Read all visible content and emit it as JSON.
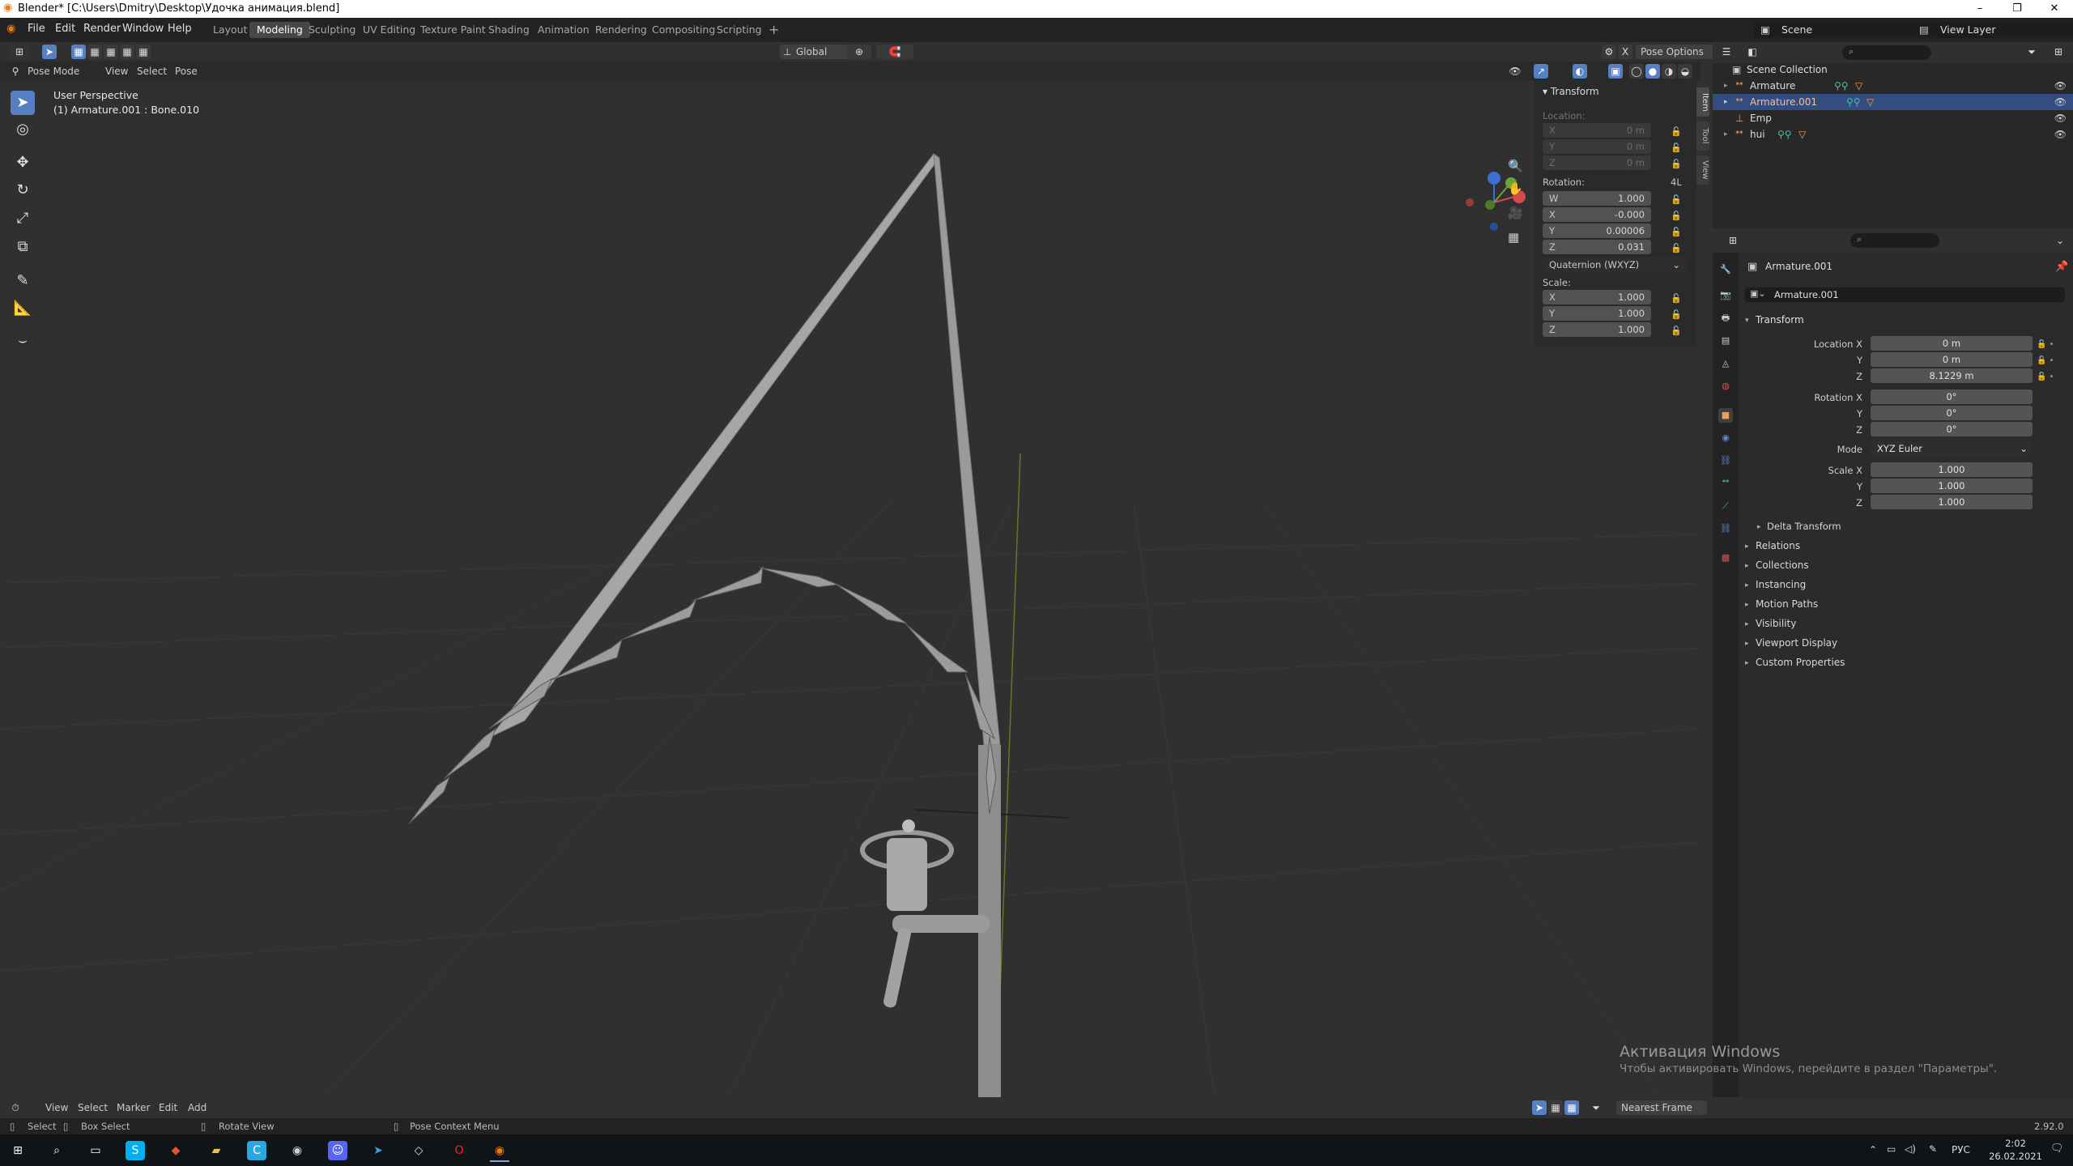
{
  "window": {
    "title": "Blender* [C:\\Users\\Dmitry\\Desktop\\Удочка анимация.blend]",
    "minimize": "–",
    "maximize": "❐",
    "close": "✕"
  },
  "menu": [
    "File",
    "Edit",
    "Render",
    "Window",
    "Help"
  ],
  "workspaces": [
    "Layout",
    "Modeling",
    "Sculpting",
    "UV Editing",
    "Texture Paint",
    "Shading",
    "Animation",
    "Rendering",
    "Compositing",
    "Scripting"
  ],
  "active_workspace": "Modeling",
  "add_workspace": "+",
  "scene": {
    "name": "Scene",
    "view_layer": "View Layer"
  },
  "header": {
    "orientation": "Global",
    "pose_options": "Pose Options",
    "mode": "Pose Mode",
    "view": "View",
    "select": "Select",
    "pose": "Pose"
  },
  "viewport": {
    "perspective": "User Perspective",
    "active": "(1) Armature.001 : Bone.010"
  },
  "transform_panel": {
    "title": "Transform",
    "location_label": "Location:",
    "location": [
      {
        "axis": "X",
        "value": "0 m"
      },
      {
        "axis": "Y",
        "value": "0 m"
      },
      {
        "axis": "Z",
        "value": "0 m"
      }
    ],
    "rotation_label": "Rotation:",
    "rotation_lock": "4L",
    "rotation": [
      {
        "axis": "W",
        "value": "1.000"
      },
      {
        "axis": "X",
        "value": "-0.000"
      },
      {
        "axis": "Y",
        "value": "0.00006"
      },
      {
        "axis": "Z",
        "value": "0.031"
      }
    ],
    "rotation_mode": "Quaternion (WXYZ)",
    "scale_label": "Scale:",
    "scale": [
      {
        "axis": "X",
        "value": "1.000"
      },
      {
        "axis": "Y",
        "value": "1.000"
      },
      {
        "axis": "Z",
        "value": "1.000"
      }
    ]
  },
  "side_tabs": [
    "Item",
    "Tool",
    "View"
  ],
  "outliner": {
    "root": "Scene Collection",
    "items": [
      {
        "name": "Armature",
        "selected": false
      },
      {
        "name": "Armature.001",
        "selected": true
      },
      {
        "name": "Emp",
        "selected": false
      },
      {
        "name": "hui",
        "selected": false
      }
    ]
  },
  "properties": {
    "object_name": "Armature.001",
    "data_name": "Armature.001",
    "transform_title": "Transform",
    "location": [
      {
        "label": "Location X",
        "value": "0 m"
      },
      {
        "label": "Y",
        "value": "0 m"
      },
      {
        "label": "Z",
        "value": "8.1229 m"
      }
    ],
    "rotation": [
      {
        "label": "Rotation X",
        "value": "0°"
      },
      {
        "label": "Y",
        "value": "0°"
      },
      {
        "label": "Z",
        "value": "0°"
      }
    ],
    "mode_label": "Mode",
    "mode_value": "XYZ Euler",
    "scale": [
      {
        "label": "Scale X",
        "value": "1.000"
      },
      {
        "label": "Y",
        "value": "1.000"
      },
      {
        "label": "Z",
        "value": "1.000"
      }
    ],
    "delta_transform": "Delta Transform",
    "sections": [
      "Relations",
      "Collections",
      "Instancing",
      "Motion Paths",
      "Visibility",
      "Viewport Display",
      "Custom Properties"
    ]
  },
  "timeline": {
    "view": "View",
    "select": "Select",
    "marker": "Marker",
    "edit": "Edit",
    "add": "Add",
    "snap": "Nearest Frame"
  },
  "statusbar": {
    "select": "Select",
    "box_select": "Box Select",
    "rotate_view": "Rotate View",
    "context_menu": "Pose Context Menu",
    "version": "2.92.0"
  },
  "watermark": {
    "line1": "Активация Windows",
    "line2": "Чтобы активировать Windows, перейдите в раздел \"Параметры\"."
  },
  "taskbar": {
    "lang": "РУС",
    "time": "2:02",
    "date": "26.02.2021"
  }
}
